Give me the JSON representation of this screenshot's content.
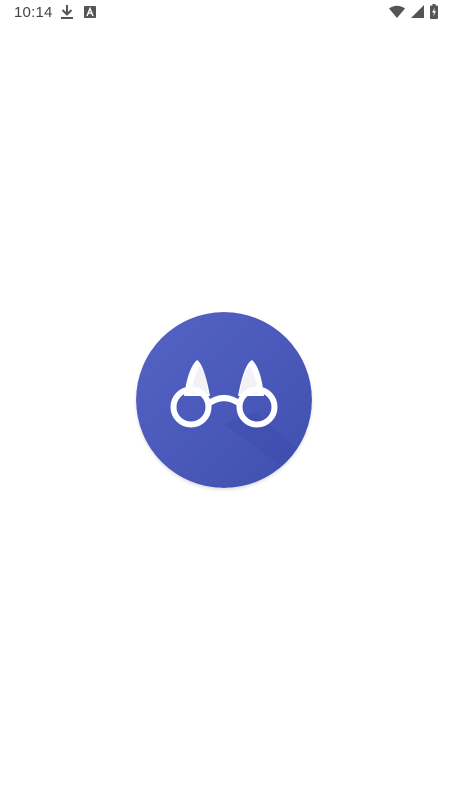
{
  "status_bar": {
    "time": "10:14",
    "left_icons": [
      "download-icon",
      "a-notification-icon"
    ],
    "right_icons": [
      "wifi-icon",
      "signal-icon",
      "battery-charging-icon"
    ]
  },
  "splash": {
    "logo": "binoculars-icon"
  },
  "colors": {
    "background": "#ffffff",
    "logo_circle": "#4554b7",
    "logo_circle_light": "#5564c4",
    "logo_glyph": "#ffffff",
    "status_icon": "#555555"
  }
}
